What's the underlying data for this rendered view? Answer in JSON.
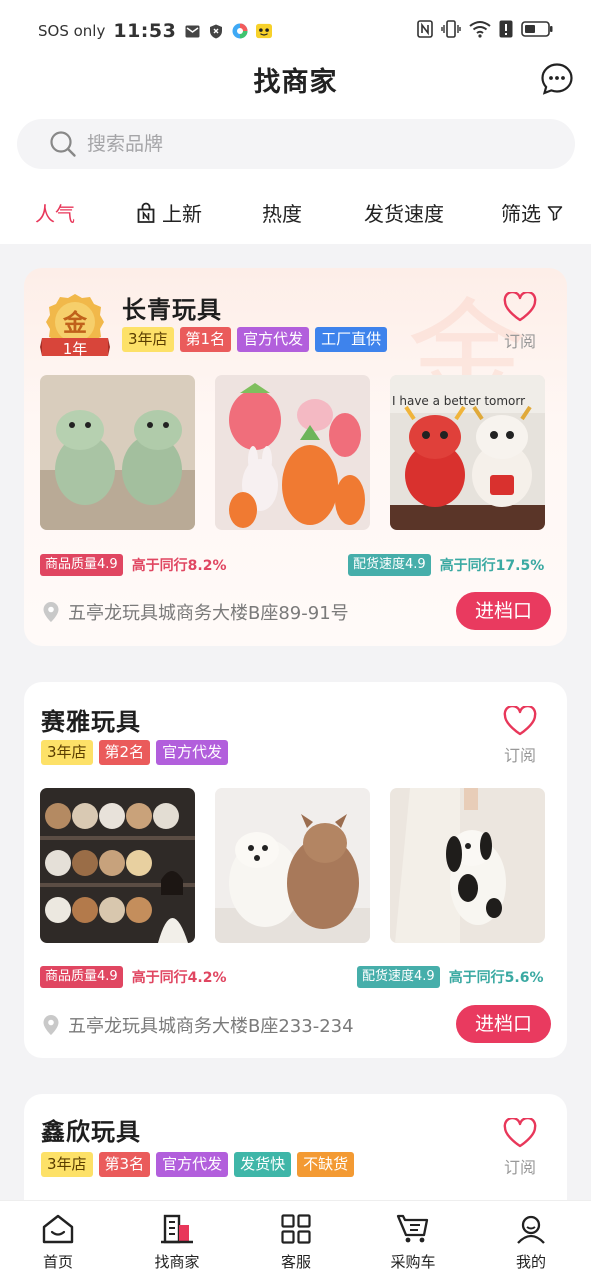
{
  "status_bar": {
    "carrier": "SOS only",
    "time": "11:53"
  },
  "header": {
    "title": "找商家"
  },
  "search": {
    "placeholder": "搜索品牌"
  },
  "tabs": [
    {
      "label": "人气"
    },
    {
      "label": "上新"
    },
    {
      "label": "热度"
    },
    {
      "label": "发货速度"
    },
    {
      "label": "筛选"
    }
  ],
  "shops": [
    {
      "name": "长青玩具",
      "badge_text": "金",
      "badge_years": "1年",
      "tags": [
        "3年店",
        "第1名",
        "官方代发",
        "工厂直供"
      ],
      "subscribe_label": "订阅",
      "quality_label": "商品质量4.9",
      "quality_compare": "高于同行8.2%",
      "speed_label": "配货速度4.9",
      "speed_compare": "高于同行17.5%",
      "address": "五亭龙玩具城商务大楼B座89-91号",
      "enter_label": "进档口",
      "image_text": "I have a better tomorr"
    },
    {
      "name": "赛雅玩具",
      "tags": [
        "3年店",
        "第2名",
        "官方代发"
      ],
      "subscribe_label": "订阅",
      "quality_label": "商品质量4.9",
      "quality_compare": "高于同行4.2%",
      "speed_label": "配货速度4.9",
      "speed_compare": "高于同行5.6%",
      "address": "五亭龙玩具城商务大楼B座233-234",
      "enter_label": "进档口"
    },
    {
      "name": "鑫欣玩具",
      "tags": [
        "3年店",
        "第3名",
        "官方代发",
        "发货快",
        "不缺货"
      ],
      "subscribe_label": "订阅"
    }
  ],
  "bottom_nav": [
    {
      "label": "首页"
    },
    {
      "label": "找商家"
    },
    {
      "label": "客服"
    },
    {
      "label": "采购车"
    },
    {
      "label": "我的"
    }
  ],
  "colors": {
    "accent": "#e8375a",
    "gold": "#e8a33a"
  }
}
